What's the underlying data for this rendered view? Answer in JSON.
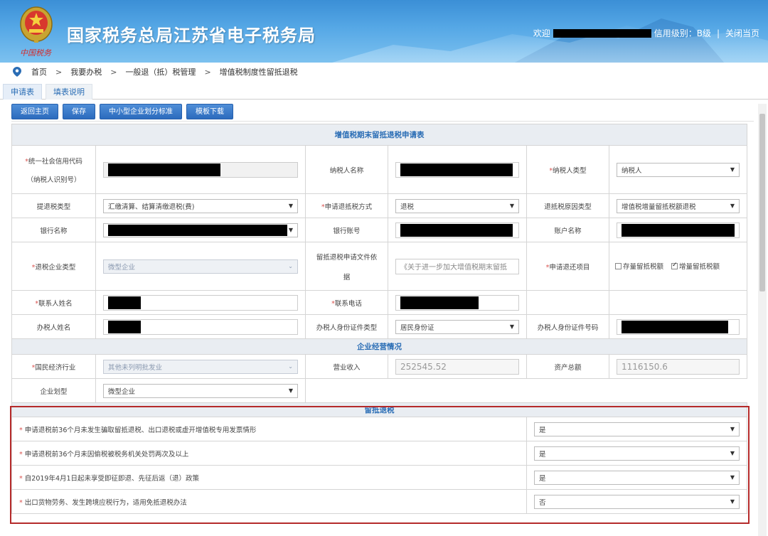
{
  "header": {
    "site_title": "国家税务总局江苏省电子税务局",
    "emblem_subtitle": "中国税务",
    "welcome": "欢迎",
    "credit_level": "信用级别：B级",
    "separator": "|",
    "close_page": "关闭当页"
  },
  "breadcrumb": {
    "items": [
      "首页",
      "我要办税",
      "一般退（抵）税管理",
      "增值税制度性留抵退税"
    ],
    "arrow": ">"
  },
  "tabs": [
    {
      "label": "申请表",
      "active": true
    },
    {
      "label": "填表说明",
      "active": false
    }
  ],
  "toolbar": {
    "back_label": "返回主页",
    "save_label": "保存",
    "sme_label": "中小型企业划分标准",
    "template_label": "模板下载"
  },
  "form": {
    "title": "增值税期末留抵退税申请表",
    "credit_code_label": "统一社会信用代码",
    "credit_code_sublabel": "（纳税人识别号）",
    "taxpayer_name_label": "纳税人名称",
    "taxpayer_type_label": "纳税人类型",
    "taxpayer_type_value": "纳税人",
    "refund_type_label": "提退税类型",
    "refund_type_value": "汇缴清算、结算清缴退税(费)",
    "refund_method_label": "申请退抵税方式",
    "refund_method_value": "退税",
    "refund_reason_label": "退抵税原因类型",
    "refund_reason_value": "增值税增量留抵税额退税",
    "bank_name_label": "银行名称",
    "bank_account_label": "银行账号",
    "account_name_label": "账户名称",
    "enterprise_type_label": "退税企业类型",
    "enterprise_type_value": "微型企业",
    "policy_basis_label_1": "留抵退税申请文件依",
    "policy_basis_label_2": "据",
    "policy_basis_value": "《关于进一步加大增值税期末留抵",
    "refund_item_label": "申请退还项目",
    "refund_item_option1": "存量留抵税额",
    "refund_item_option2": "增量留抵税额",
    "contact_name_label": "联系人姓名",
    "contact_phone_label": "联系电话",
    "handler_name_label": "办税人姓名",
    "handler_id_type_label": "办税人身份证件类型",
    "handler_id_type_value": "居民身份证",
    "handler_id_number_label": "办税人身份证件号码",
    "operation_section": "企业经营情况",
    "industry_label": "国民经济行业",
    "industry_value": "其他未列明批发业",
    "revenue_label": "营业收入",
    "revenue_value": "252545.52",
    "assets_label": "资产总额",
    "assets_value": "1116150.6",
    "size_label": "企业划型",
    "size_value": "微型企业",
    "retention_section": "留抵退税",
    "questions": [
      {
        "text": "申请退税前36个月未发生骗取留抵退税、出口退税或虚开增值税专用发票情形",
        "value": "是"
      },
      {
        "text": "申请退税前36个月未因偷税被税务机关处罚两次及以上",
        "value": "是"
      },
      {
        "text": "自2019年4月1日起未享受即征即退、先征后返（退）政策",
        "value": "是"
      },
      {
        "text": "出口货物劳务、发生跨境应税行为，适用免抵退税办法",
        "value": "否"
      }
    ]
  },
  "colors": {
    "header_blue": "#3b8fd6",
    "button_blue": "#2c6bbd",
    "section_text": "#2a6db5",
    "required_red": "#d9534f",
    "highlight_red": "#b52a2a"
  }
}
